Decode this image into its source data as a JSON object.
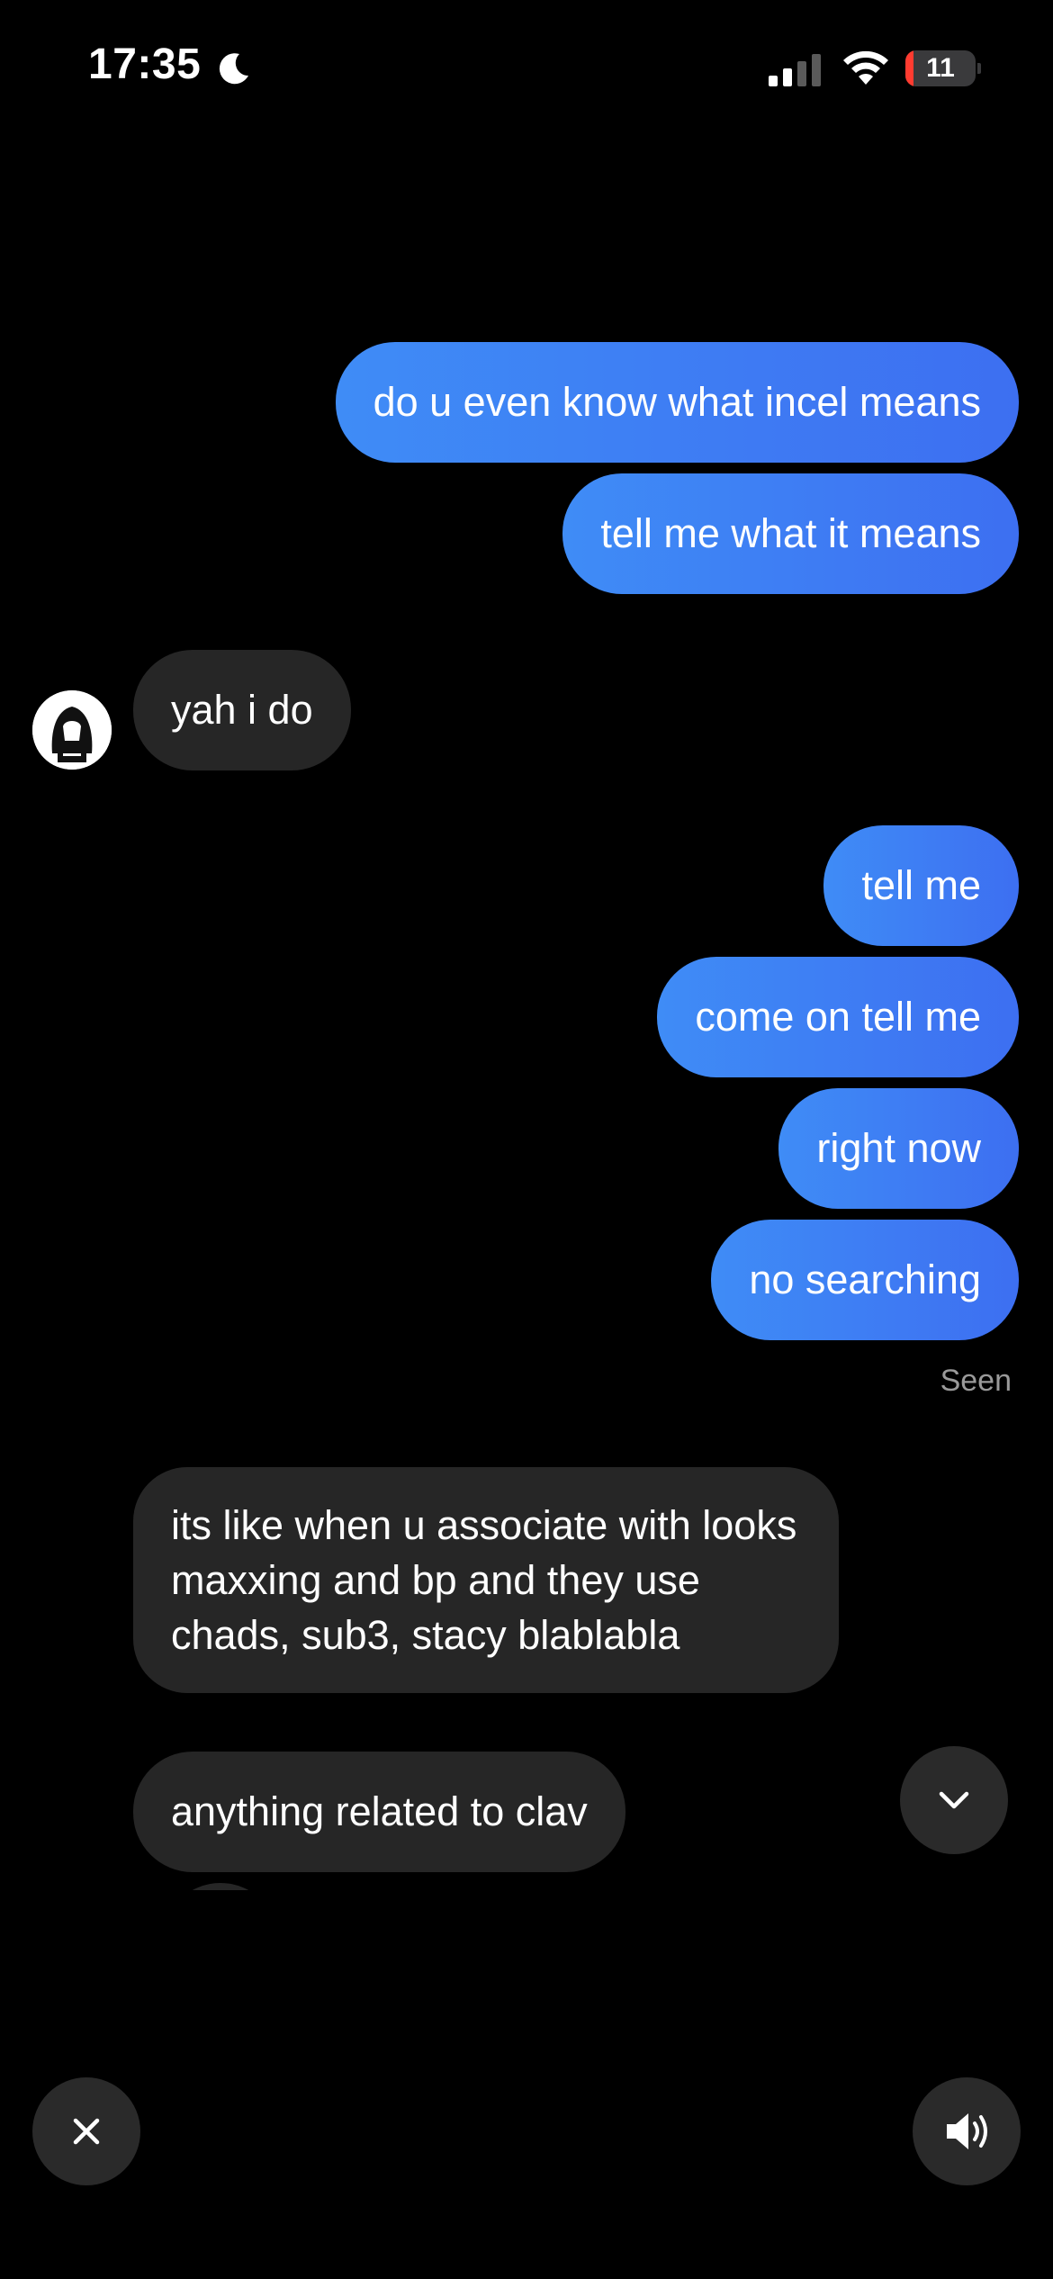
{
  "status_bar": {
    "time": "17:35",
    "moon_icon": "moon-icon",
    "signal_icon": "cellular-signal-icon",
    "wifi_icon": "wifi-icon",
    "battery_level": "11",
    "battery_fraction": 0.11
  },
  "messages": [
    {
      "direction": "outgoing",
      "text": "do u even know what incel means"
    },
    {
      "direction": "outgoing",
      "text": "tell me what it means"
    },
    {
      "direction": "incoming",
      "text": "yah i do"
    },
    {
      "direction": "outgoing",
      "text": "tell me"
    },
    {
      "direction": "outgoing",
      "text": "come on tell me"
    },
    {
      "direction": "outgoing",
      "text": "right now"
    },
    {
      "direction": "outgoing",
      "text": "no searching"
    },
    {
      "direction": "incoming",
      "text": "its like when u associate with looks maxxing and bp and they use chads, sub3, stacy blablabla"
    },
    {
      "direction": "incoming",
      "text": "anything related to clav"
    }
  ],
  "read_receipt": "Seen",
  "controls": {
    "scroll_down_icon": "chevron-down-icon",
    "close_icon": "close-icon",
    "sound_icon": "speaker-icon"
  },
  "colors": {
    "background": "#000000",
    "outgoing_bubble_start": "#3f92f7",
    "outgoing_bubble_end": "#4b4ee8",
    "incoming_bubble": "#262626",
    "battery_low": "#ff3b30"
  }
}
